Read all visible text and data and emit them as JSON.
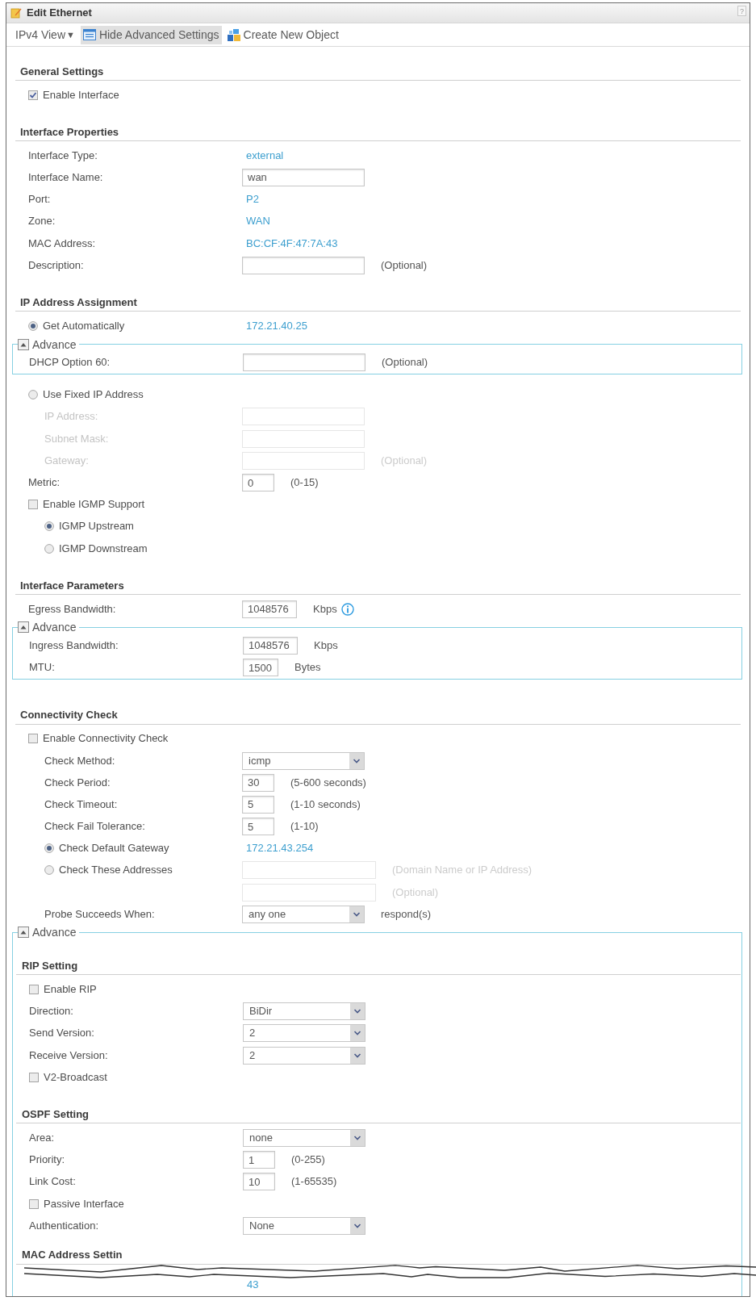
{
  "window": {
    "title": "Edit Ethernet",
    "help": "?"
  },
  "toolbar": [
    {
      "kind": "menu",
      "label": "IPv4 View",
      "arrow": "▼",
      "selected": false
    },
    {
      "kind": "toggle",
      "label": "Hide Advanced Settings",
      "selected": true
    },
    {
      "kind": "create",
      "label": "Create New Object",
      "selected": false
    }
  ],
  "blocks": [
    {
      "kind": "section",
      "title": "General Settings",
      "rows": [
        {
          "kind": "checkbox",
          "label": "Enable Interface",
          "checked": true
        }
      ]
    },
    {
      "kind": "section",
      "title": "Interface Properties",
      "rows": [
        {
          "kind": "text",
          "label": "Interface Type:",
          "value": "external"
        },
        {
          "kind": "input",
          "label": "Interface Name:",
          "value": "wan"
        },
        {
          "kind": "text",
          "label": "Port:",
          "value": "P2"
        },
        {
          "kind": "text",
          "label": "Zone:",
          "value": "WAN"
        },
        {
          "kind": "text",
          "label": "MAC Address:",
          "value": "BC:CF:4F:47:7A:43"
        },
        {
          "kind": "input",
          "label": "Description:",
          "hint": "(Optional)"
        }
      ]
    },
    {
      "kind": "section",
      "title": "IP Address Assignment",
      "rows": [
        {
          "kind": "radio",
          "label": "Get Automatically",
          "selected": true,
          "value": "172.21.40.25"
        },
        {
          "kind": "advance",
          "legend": "Advance",
          "expanded": true,
          "rows": [
            {
              "kind": "input",
              "label": "DHCP Option 60:",
              "hint": "(Optional)"
            }
          ]
        },
        {
          "kind": "radio",
          "label": "Use Fixed IP Address",
          "selected": false,
          "children": [
            {
              "kind": "input",
              "label": "IP Address:",
              "disabled": true
            },
            {
              "kind": "input",
              "label": "Subnet Mask:",
              "disabled": true
            },
            {
              "kind": "input",
              "label": "Gateway:",
              "disabled": true,
              "hint": "(Optional)"
            }
          ]
        },
        {
          "kind": "number",
          "label": "Metric:",
          "value": "0",
          "hint": "(0-15)"
        },
        {
          "kind": "checkbox",
          "label": "Enable IGMP Support",
          "checked": false,
          "children": [
            {
              "kind": "radio",
              "label": "IGMP Upstream",
              "selected": true
            },
            {
              "kind": "radio",
              "label": "IGMP Downstream",
              "selected": false
            }
          ]
        }
      ]
    },
    {
      "kind": "section",
      "title": "Interface Parameters",
      "rows": [
        {
          "kind": "number",
          "label": "Egress Bandwidth:",
          "value": "1048576",
          "hint": "Kbps",
          "info": true
        },
        {
          "kind": "advance",
          "legend": "Advance",
          "expanded": true,
          "rows": [
            {
              "kind": "number",
              "label": "Ingress Bandwidth:",
              "value": "1048576",
              "hint": "Kbps"
            },
            {
              "kind": "number",
              "label": "MTU:",
              "value": "1500",
              "hint": "Bytes"
            }
          ]
        }
      ]
    },
    {
      "kind": "section",
      "title": "Connectivity Check",
      "rows": [
        {
          "kind": "checkbox",
          "label": "Enable Connectivity Check",
          "checked": false,
          "children": [
            {
              "kind": "select",
              "label": "Check Method:",
              "value": "icmp"
            },
            {
              "kind": "number",
              "label": "Check Period:",
              "value": "30",
              "hint": "(5-600 seconds)"
            },
            {
              "kind": "number",
              "label": "Check Timeout:",
              "value": "5",
              "hint": "(1-10 seconds)"
            },
            {
              "kind": "number",
              "label": "Check Fail Tolerance:",
              "value": "5",
              "hint": "(1-10)"
            },
            {
              "kind": "radio",
              "label": "Check Default Gateway",
              "selected": true,
              "value": "172.21.43.254"
            },
            {
              "kind": "radio",
              "label": "Check These Addresses",
              "selected": false,
              "fields": [
                {
                  "hint": "(Domain Name or IP Address)",
                  "disabled": true
                },
                {
                  "hint": "(Optional)",
                  "disabled": true
                }
              ]
            },
            {
              "kind": "select",
              "label": "Probe Succeeds When:",
              "value": "any one",
              "hint": "respond(s)"
            }
          ]
        }
      ]
    },
    {
      "kind": "advance",
      "legend": "Advance",
      "expanded": true,
      "blocks": [
        {
          "kind": "section",
          "title": "RIP Setting",
          "rows": [
            {
              "kind": "checkbox",
              "label": "Enable RIP",
              "checked": false
            },
            {
              "kind": "select",
              "label": "Direction:",
              "value": "BiDir"
            },
            {
              "kind": "select",
              "label": "Send Version:",
              "value": "2"
            },
            {
              "kind": "select",
              "label": "Receive Version:",
              "value": "2"
            },
            {
              "kind": "checkbox",
              "label": "V2-Broadcast",
              "checked": false
            }
          ]
        },
        {
          "kind": "section",
          "title": "OSPF Setting",
          "rows": [
            {
              "kind": "select",
              "label": "Area:",
              "value": "none"
            },
            {
              "kind": "number",
              "label": "Priority:",
              "value": "1",
              "hint": "(0-255)"
            },
            {
              "kind": "number",
              "label": "Link Cost:",
              "value": "10",
              "hint": "(1-65535)"
            },
            {
              "kind": "checkbox",
              "label": "Passive Interface",
              "checked": false
            },
            {
              "kind": "select",
              "label": "Authentication:",
              "value": "None"
            }
          ]
        },
        {
          "kind": "section",
          "title": "MAC Address Settin",
          "rows": [
            {
              "kind": "text",
              "value": "43"
            }
          ]
        }
      ]
    }
  ]
}
